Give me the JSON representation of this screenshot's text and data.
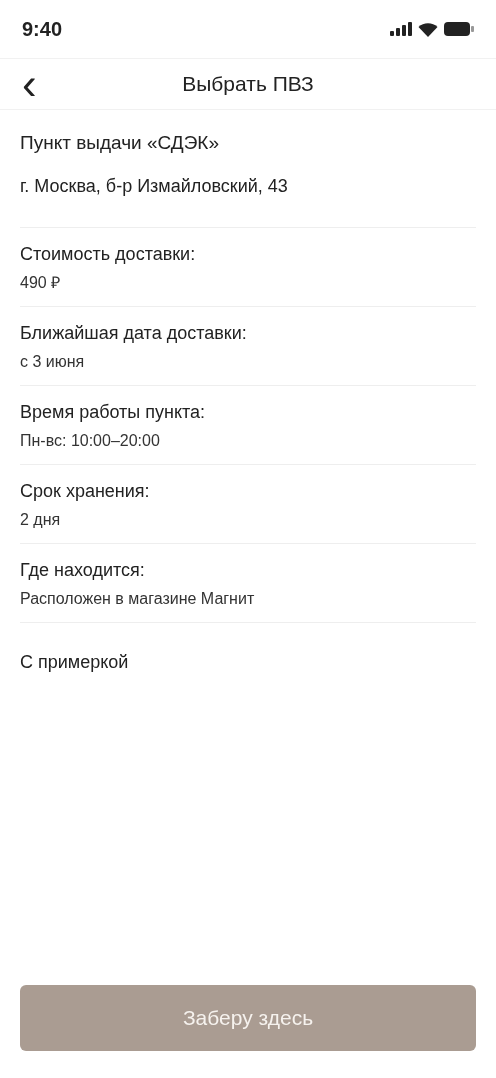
{
  "status_bar": {
    "time": "9:40"
  },
  "header": {
    "back": "‹",
    "title": "Выбрать ПВЗ"
  },
  "point": {
    "name": "Пункт выдачи «СДЭК»",
    "address": "г. Москва, б-р Измайловский, 43"
  },
  "details": [
    {
      "label": "Стоимость доставки:",
      "value": "490 ₽"
    },
    {
      "label": "Ближайшая дата доставки:",
      "value": "с 3 июня"
    },
    {
      "label": "Время работы пункта:",
      "value": "Пн-вс: 10:00–20:00"
    },
    {
      "label": "Срок хранения:",
      "value": "2 дня"
    },
    {
      "label": "Где находится:",
      "value": "Расположен в магазине Магнит"
    }
  ],
  "fitting": "С примеркой",
  "button": {
    "label": "Заберу здесь",
    "disabled": true
  }
}
